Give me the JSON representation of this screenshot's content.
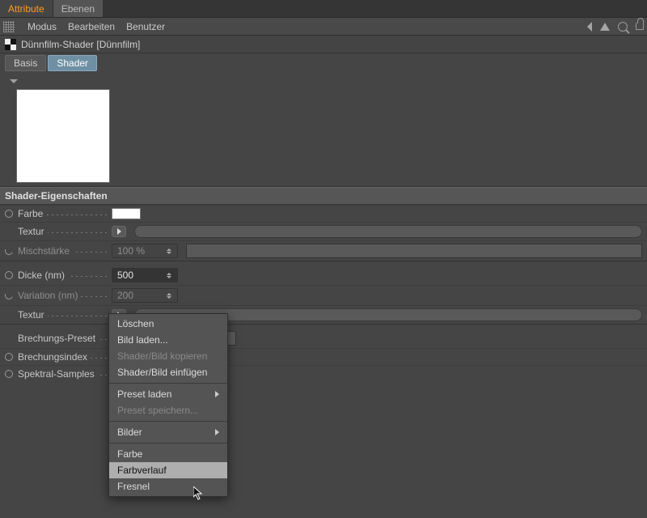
{
  "tabs": {
    "attribute": "Attribute",
    "layers": "Ebenen"
  },
  "menu": {
    "mode": "Modus",
    "edit": "Bearbeiten",
    "user": "Benutzer"
  },
  "title": "Dünnfilm-Shader [Dünnfilm]",
  "subtabs": {
    "basis": "Basis",
    "shader": "Shader"
  },
  "section": "Shader-Eigenschaften",
  "props": {
    "color": "Farbe",
    "texture1": "Textur",
    "mixstrength": "Mischstärke",
    "mixstrength_val": "100 %",
    "thickness": "Dicke (nm)",
    "thickness_val": "500",
    "variation": "Variation (nm)",
    "variation_val": "200",
    "texture2": "Textur",
    "refraction_preset": "Brechungs-Preset",
    "refraction_index": "Brechungsindex",
    "spectral_samples": "Spektral-Samples"
  },
  "context": {
    "delete": "Löschen",
    "loadimg": "Bild laden...",
    "copy": "Shader/Bild kopieren",
    "paste": "Shader/Bild einfügen",
    "preset_load": "Preset laden",
    "preset_save": "Preset speichern...",
    "images": "Bilder",
    "color": "Farbe",
    "gradient": "Farbverlauf",
    "fresnel": "Fresnel"
  }
}
